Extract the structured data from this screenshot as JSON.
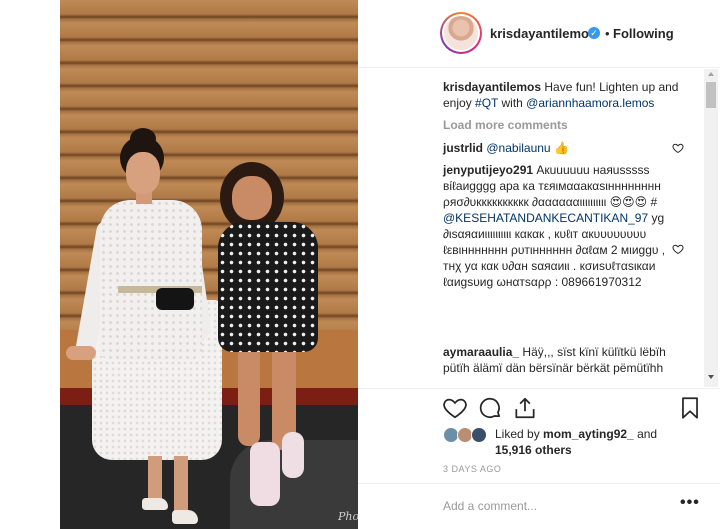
{
  "post": {
    "username": "krisdayantilemos",
    "dot": "•",
    "follow_status": "Following",
    "watermark": "Photo..."
  },
  "caption": {
    "user": "krisdayantilemos",
    "text": " Have fun! Lighten up and enjoy ",
    "hashtag": "#QT",
    "with": " with ",
    "mention": "@ariannhaamora.lemos"
  },
  "load_more": "Load more comments",
  "comments": [
    {
      "user": "justrlid",
      "mention": "@nabilaunu",
      "emoji": "👍"
    },
    {
      "user": "jenyputijeyo291",
      "text": " Акuuuuuu нaяusssss вίℓaиgggg apa ка тεяιмααакαѕιнннннннн ρяσ∂υкккккккккк ∂ααααααιιιιιιιιιι 😍😍😍 # "
    },
    {
      "mention": "@KESEHATANDANKECANTIKAN_97",
      "text": " yg ∂ιѕαяαиιιιιιιιιιι кαкαк , кυℓιт αкυυυυυυυυ ℓεвιннннннн ρυтιнннннн ∂αℓαм 2 мιиggυ , тнχ уα кαк υ∂αн ѕαяαиιι . кσиѕυℓтαѕιкαи ℓαиgѕυиg ωнαтѕαρρ : 089661970312"
    },
    {
      "user": "aymaraaulia_",
      "text": " Ηäÿ,,, ѕïѕt kïnï külïtkü lëbïh pütïh älämï dän bërsïnär bërkät pëmütïhh"
    }
  ],
  "likes": {
    "prefix": "Liked by ",
    "user": "mom_ayting92_",
    "and": " and",
    "others": "15,916 others"
  },
  "timestamp": "3 DAYS AGO",
  "add_comment_placeholder": "Add a comment...",
  "more_label": "•••",
  "colors": {
    "link": "#003569",
    "verified": "#3897f0",
    "muted": "#999999"
  },
  "icons": [
    "verified-badge-icon",
    "heart-icon",
    "comment-icon",
    "share-icon",
    "bookmark-icon",
    "more-options-icon"
  ]
}
